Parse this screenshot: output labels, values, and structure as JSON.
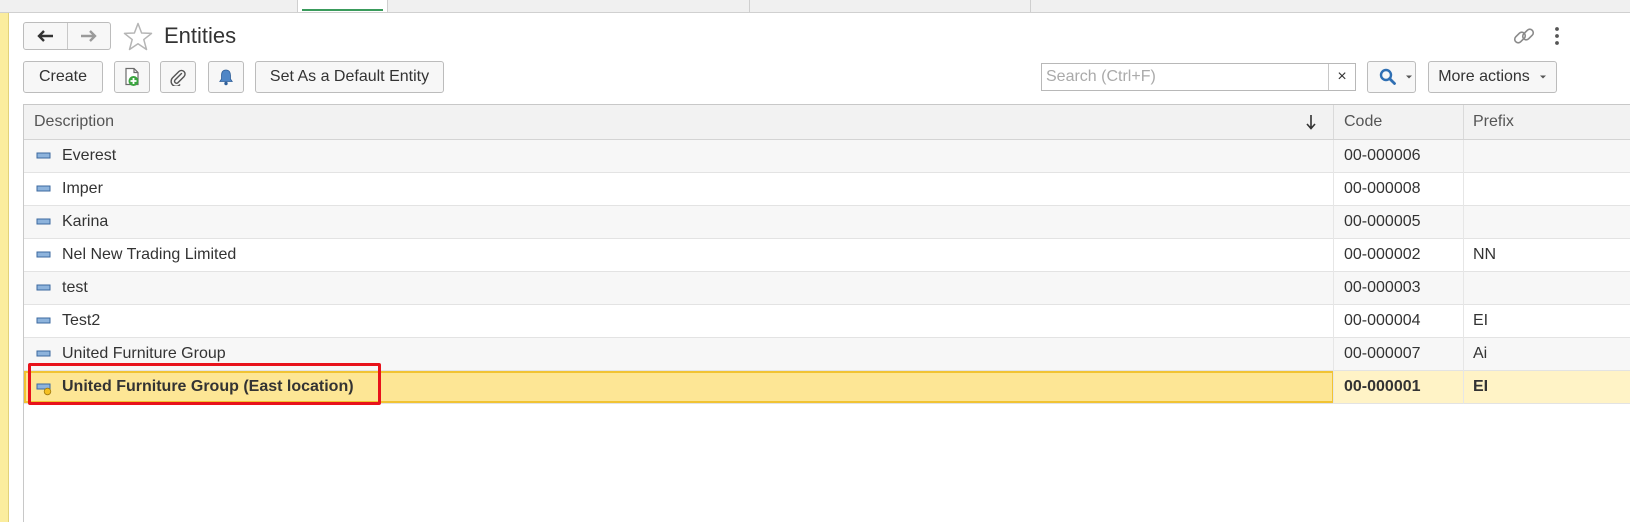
{
  "page": {
    "title": "Entities"
  },
  "toolbar": {
    "create_label": "Create",
    "set_default_label": "Set As a Default Entity",
    "search_placeholder": "Search (Ctrl+F)",
    "clear_label": "×",
    "more_actions_label": "More actions"
  },
  "icons": {
    "back": "arrow-left-icon",
    "forward": "arrow-right-icon",
    "favorite": "star-icon",
    "link": "link-icon",
    "menu": "kebab-menu-icon",
    "create_from_copy": "document-add-icon",
    "attach": "paperclip-icon",
    "notify": "bell-icon",
    "search": "search-icon",
    "sort": "sort-down-icon"
  },
  "colors": {
    "accent": "#3a9b5c",
    "selection_fill": "#fde695",
    "selection_border": "#f1c333",
    "highlight_annotation": "#e8121b",
    "side_strip": "#fbed9e"
  },
  "table": {
    "columns": {
      "description": "Description",
      "code": "Code",
      "prefix": "Prefix"
    },
    "sort": "Description descending-arrow",
    "rows": [
      {
        "description": "Everest",
        "code": "00-000006",
        "prefix": ""
      },
      {
        "description": "Imper",
        "code": "00-000008",
        "prefix": ""
      },
      {
        "description": "Karina",
        "code": "00-000005",
        "prefix": ""
      },
      {
        "description": "Nel New Trading Limited",
        "code": "00-000002",
        "prefix": "NN"
      },
      {
        "description": "test",
        "code": "00-000003",
        "prefix": ""
      },
      {
        "description": "Test2",
        "code": "00-000004",
        "prefix": "EI"
      },
      {
        "description": "United Furniture Group",
        "code": "00-000007",
        "prefix": "Ai"
      },
      {
        "description": "United Furniture Group (East location)",
        "code": "00-000001",
        "prefix": "EI",
        "selected": true,
        "is_default": true
      }
    ]
  }
}
